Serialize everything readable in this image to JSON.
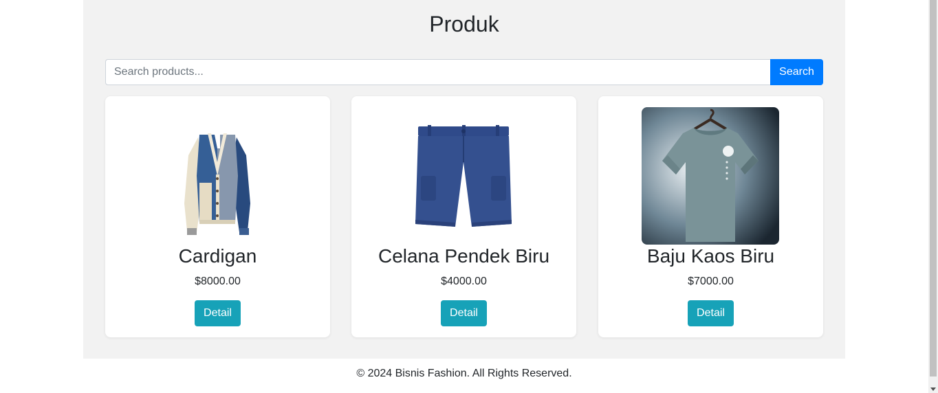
{
  "page_title": "Produk",
  "search": {
    "placeholder": "Search products...",
    "value": "",
    "button_label": "Search"
  },
  "products": [
    {
      "name": "Cardigan",
      "price": "$8000.00",
      "button_label": "Detail",
      "image_icon": "cardigan-image"
    },
    {
      "name": "Celana Pendek Biru",
      "price": "$4000.00",
      "button_label": "Detail",
      "image_icon": "shorts-image"
    },
    {
      "name": "Baju Kaos Biru",
      "price": "$7000.00",
      "button_label": "Detail",
      "image_icon": "tshirt-image"
    }
  ],
  "footer": {
    "text": "© 2024 Bisnis Fashion. All Rights Reserved."
  },
  "colors": {
    "primary": "#007bff",
    "info": "#17a2b8",
    "container_bg": "#f2f2f2"
  }
}
